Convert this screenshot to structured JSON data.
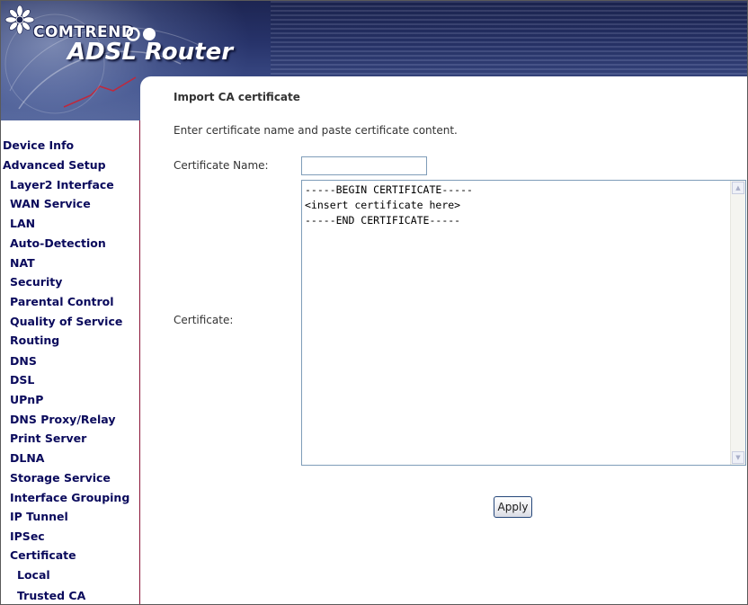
{
  "header": {
    "brand": "COMTREND",
    "product": "ADSL Router",
    "icons": [
      "comtrend-flower-logo-icon",
      "comtrend-rings-icon"
    ]
  },
  "sidebar": {
    "items": [
      {
        "label": "Device Info",
        "level": 1
      },
      {
        "label": "Advanced Setup",
        "level": 1
      },
      {
        "label": "Layer2 Interface",
        "level": 2
      },
      {
        "label": "WAN Service",
        "level": 2
      },
      {
        "label": "LAN",
        "level": 2
      },
      {
        "label": "Auto-Detection",
        "level": 2
      },
      {
        "label": "NAT",
        "level": 2
      },
      {
        "label": "Security",
        "level": 2
      },
      {
        "label": "Parental Control",
        "level": 2
      },
      {
        "label": "Quality of Service",
        "level": 2
      },
      {
        "label": "Routing",
        "level": 2
      },
      {
        "label": "DNS",
        "level": 2
      },
      {
        "label": "DSL",
        "level": 2
      },
      {
        "label": "UPnP",
        "level": 2
      },
      {
        "label": "DNS Proxy/Relay",
        "level": 2
      },
      {
        "label": "Print Server",
        "level": 2
      },
      {
        "label": "DLNA",
        "level": 2
      },
      {
        "label": "Storage Service",
        "level": 2
      },
      {
        "label": "Interface Grouping",
        "level": 2
      },
      {
        "label": "IP Tunnel",
        "level": 2
      },
      {
        "label": "IPSec",
        "level": 2
      },
      {
        "label": "Certificate",
        "level": 2
      },
      {
        "label": "Local",
        "level": 3
      },
      {
        "label": "Trusted CA",
        "level": 3
      }
    ]
  },
  "main": {
    "title": "Import CA certificate",
    "description": "Enter certificate name and paste certificate content.",
    "name_label": "Certificate Name:",
    "name_value": "",
    "cert_label": "Certificate:",
    "cert_value": "-----BEGIN CERTIFICATE-----\n<insert certificate here>\n-----END CERTIFICATE-----",
    "apply_label": "Apply"
  },
  "colors": {
    "menu_text": "#0a0a5c",
    "sidebar_border": "#8a1538",
    "banner_dark": "#1d2552"
  }
}
